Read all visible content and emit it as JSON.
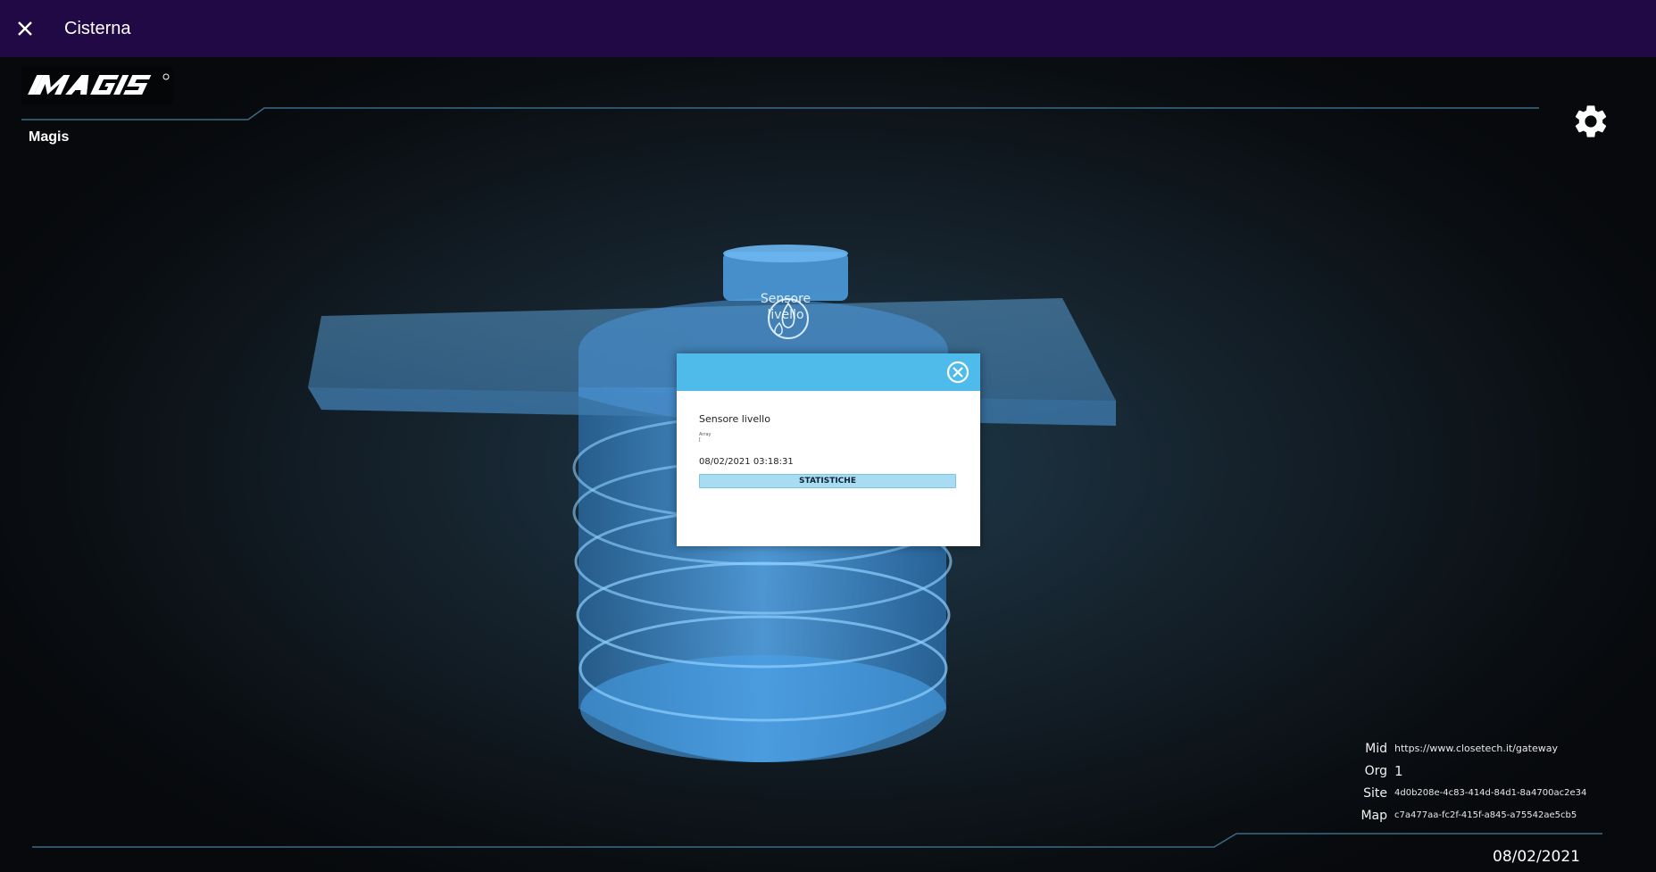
{
  "window": {
    "title": "Cisterna"
  },
  "brand": {
    "logo_text": "MAGIS",
    "label": "Magis"
  },
  "scene": {
    "sensor_label_line1": "Sensore",
    "sensor_label_line2": "livello"
  },
  "popup": {
    "sensor_name": "Sensore livello",
    "type": "Array",
    "value": "[",
    "timestamp": "08/02/2021 03:18:31",
    "stats_button": "STATISTICHE"
  },
  "info": {
    "mid_label": "Mid",
    "mid_value": "https://www.closetech.it/gateway",
    "org_label": "Org",
    "org_value": "1",
    "site_label": "Site",
    "site_value": "4d0b208e-4c83-414d-84d1-8a4700ac2e34",
    "map_label": "Map",
    "map_value": "c7a477aa-fc2f-415f-a845-a75542ae5cb5"
  },
  "footer": {
    "date": "08/02/2021"
  },
  "colors": {
    "titlebar": "#200944",
    "popup_header": "#4ebbea",
    "stats_button": "#a8dcf3",
    "accent_lines": "#3b6a86",
    "tank": "#3e8fd8"
  },
  "icons": {
    "close": "close-icon",
    "settings": "gear-icon",
    "popup_close": "close-circle-icon",
    "sensor": "water-drops-icon"
  }
}
